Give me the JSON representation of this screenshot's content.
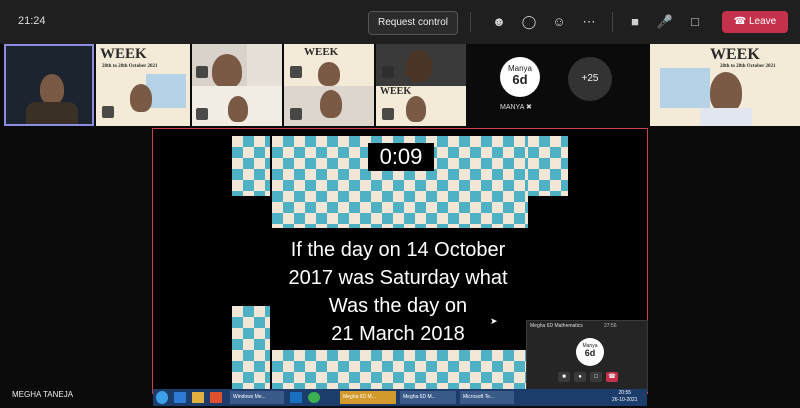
{
  "topbar": {
    "time": "21:24",
    "request_control_label": "Request control",
    "leave_label": "Leave",
    "icons": [
      "people-icon",
      "chat-icon",
      "react-icon",
      "more-icon",
      "camera-icon",
      "mic-off-icon",
      "share-icon",
      "phone-icon"
    ]
  },
  "tiles": {
    "poster_text_1": "WEEK",
    "poster_date_1": "28th to 28th October 2021",
    "poster_text_2": "WEEK",
    "poster_text_3": "WEEK",
    "manya_avatar_name": "Manya",
    "manya_avatar_class": "6d",
    "manya_label": "MANYA",
    "overflow_count": "+25",
    "right_poster_text": "WEEK",
    "right_poster_date": "28th to 28th October 2021"
  },
  "share": {
    "timer": "0:09",
    "question_lines": [
      "If the day on 14 October",
      "2017 was Saturday what",
      "Was the day on",
      "21 March 2018"
    ]
  },
  "mini_window": {
    "title": "Megha 6D Mathematics",
    "time": "27:56",
    "avatar_name": "Manya",
    "avatar_class": "6d"
  },
  "taskbar": {
    "items": [
      "Windows Me...",
      "Megha 6D M...",
      "Megha 6D M...",
      "Microsoft Te..."
    ],
    "clock": "20:55",
    "date": "26-10-2021"
  },
  "presenter_name": "MEGHA TANEJA",
  "colors": {
    "leave": "#c4314b",
    "share_border": "#d04040",
    "pattern_teal": "#4fb1c4",
    "pattern_cream": "#f2e7d7"
  }
}
